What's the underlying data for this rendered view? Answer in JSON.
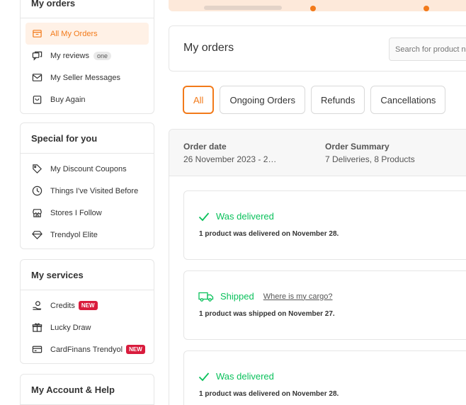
{
  "sidebar": {
    "orders_card": {
      "title": "My orders",
      "items": [
        {
          "label": "All My Orders"
        },
        {
          "label": "My reviews",
          "pill": "one"
        },
        {
          "label": "My Seller Messages"
        },
        {
          "label": "Buy Again"
        }
      ]
    },
    "special_card": {
      "title": "Special for you",
      "items": [
        {
          "label": "My Discount Coupons"
        },
        {
          "label": "Things I've Visited Before"
        },
        {
          "label": "Stores I Follow"
        },
        {
          "label": "Trendyol Elite"
        }
      ]
    },
    "services_card": {
      "title": "My services",
      "items": [
        {
          "label": "Credits",
          "badge": "NEW"
        },
        {
          "label": "Lucky Draw"
        },
        {
          "label": "CardFinans Trendyol",
          "badge": "NEW"
        }
      ]
    },
    "account_card": {
      "title": "My Account & Help"
    }
  },
  "main": {
    "title": "My orders",
    "search_placeholder": "Search for product name",
    "tabs": [
      {
        "label": "All",
        "active": true
      },
      {
        "label": "Ongoing Orders"
      },
      {
        "label": "Refunds"
      },
      {
        "label": "Cancellations"
      }
    ],
    "order": {
      "date_label": "Order date",
      "date_value": "26 November 2023 - 2…",
      "summary_label": "Order Summary",
      "summary_value": "7 Deliveries, 8 Products",
      "deliveries": [
        {
          "status": "Was delivered",
          "note": "1 product was delivered on November 28."
        },
        {
          "status": "Shipped",
          "link": "Where is my cargo?",
          "note": "1 product was shipped on November 27."
        },
        {
          "status": "Was delivered",
          "note": "1 product was delivered on November 28."
        }
      ]
    }
  },
  "colors": {
    "accent": "#f27a1a",
    "success": "#0bc15c",
    "new_badge": "#d91c3d"
  }
}
